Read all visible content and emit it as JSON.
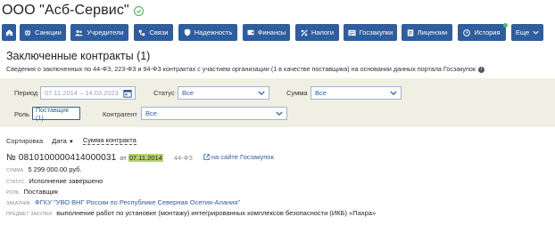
{
  "company": {
    "name": "ООО \"Асб-Сервис\""
  },
  "nav": {
    "home_icon": "home-icon",
    "buttons": [
      {
        "label": "Санкции",
        "icon": "globe-icon"
      },
      {
        "label": "Учредители",
        "icon": "users-icon"
      },
      {
        "label": "Связи",
        "icon": "link-icon"
      },
      {
        "label": "Надежность",
        "icon": "shield-icon"
      },
      {
        "label": "Финансы",
        "icon": "wallet-icon"
      },
      {
        "label": "Налоги",
        "icon": "tax-icon"
      },
      {
        "label": "Госзакупки",
        "icon": "tender-icon"
      },
      {
        "label": "Лицензии",
        "icon": "license-icon"
      },
      {
        "label": "История",
        "icon": "clock-icon"
      },
      {
        "label": "Еще",
        "icon": "chevron-down-icon"
      }
    ]
  },
  "section": {
    "title": "Заключенные контракты (1)",
    "subtitle": "Сведения о заключенных по 44-ФЗ, 223-ФЗ и 94-ФЗ контрактах с участием организации (1 в качестве поставщика) на основании данных портала Госзакупок"
  },
  "filters": {
    "period_label": "Период",
    "period_value": "07.11.2014  –  14.03.2023",
    "status_label": "Статус",
    "status_value": "Все",
    "sum_label": "Сумма",
    "sum_value": "Все",
    "role_label": "Роль",
    "role_value": "Поставщик (1)",
    "contragent_label": "Контрагент",
    "contragent_value": "Все"
  },
  "sorting": {
    "label": "Сортировка",
    "by_date": "Дата",
    "by_sum": "Сумма контракта"
  },
  "contract": {
    "number": "№ 0810100000414000031",
    "from": "от",
    "date": "07.11.2014",
    "law": "44-ФЗ",
    "portal_link": "на сайте Госзакупок",
    "sum_label": "сумма",
    "sum_value": "5 299 000.00 руб.",
    "status_label": "статус",
    "status_value": "Исполнение завершено",
    "role_label": "роль",
    "role_value": "Поставщик",
    "customer_label": "заказчик",
    "customer_value": "ФГКУ \"УВО ВНГ России по Республике Северная Осетия-Алания\"",
    "subject_label": "предмет закупки",
    "subject_value": "выполнение работ по установке (монтажу) интегрированных комплексов безопасности (ИКБ) «Пахра»"
  }
}
